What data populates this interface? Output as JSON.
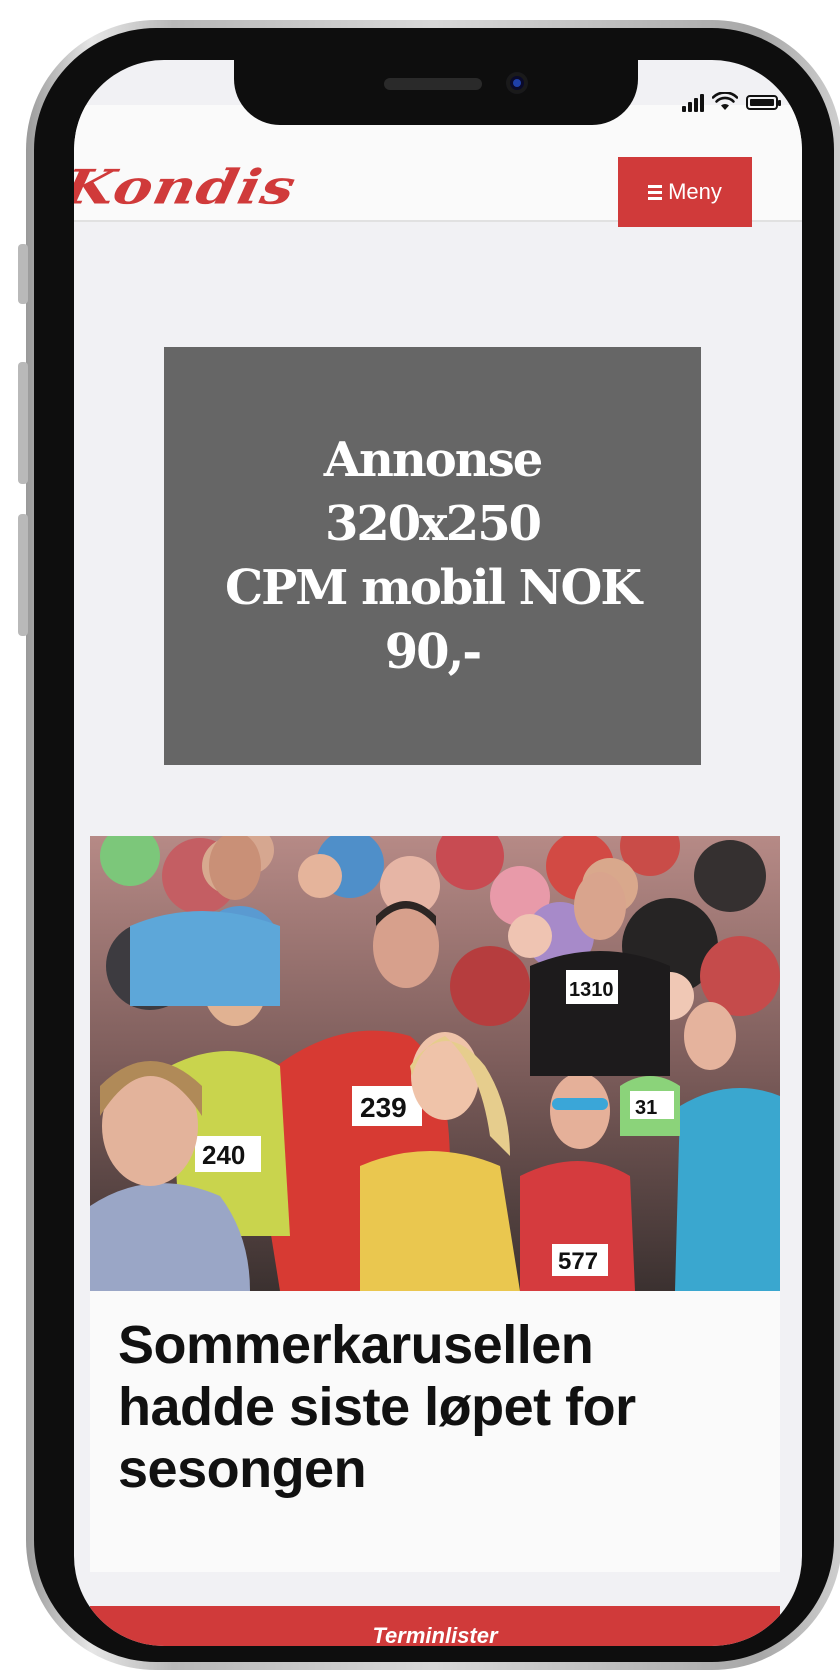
{
  "header": {
    "logo_text": "Kondis",
    "menu_label": "Meny"
  },
  "status_bar": {
    "icons": [
      "signal-icon",
      "wifi-icon",
      "battery-icon"
    ]
  },
  "ad": {
    "text": "Annonse\n320x250\nCPM mobil NOK\n90,-"
  },
  "article": {
    "title": "Sommerkarusellen hadde siste løpet for sesongen",
    "bib_numbers": [
      "239",
      "240",
      "1310",
      "577",
      "31"
    ]
  },
  "footer": {
    "terminlister_label": "Terminlister"
  },
  "colors": {
    "accent": "#d03a3a",
    "ad_background": "#666666",
    "page_background": "#f1f1f4"
  }
}
